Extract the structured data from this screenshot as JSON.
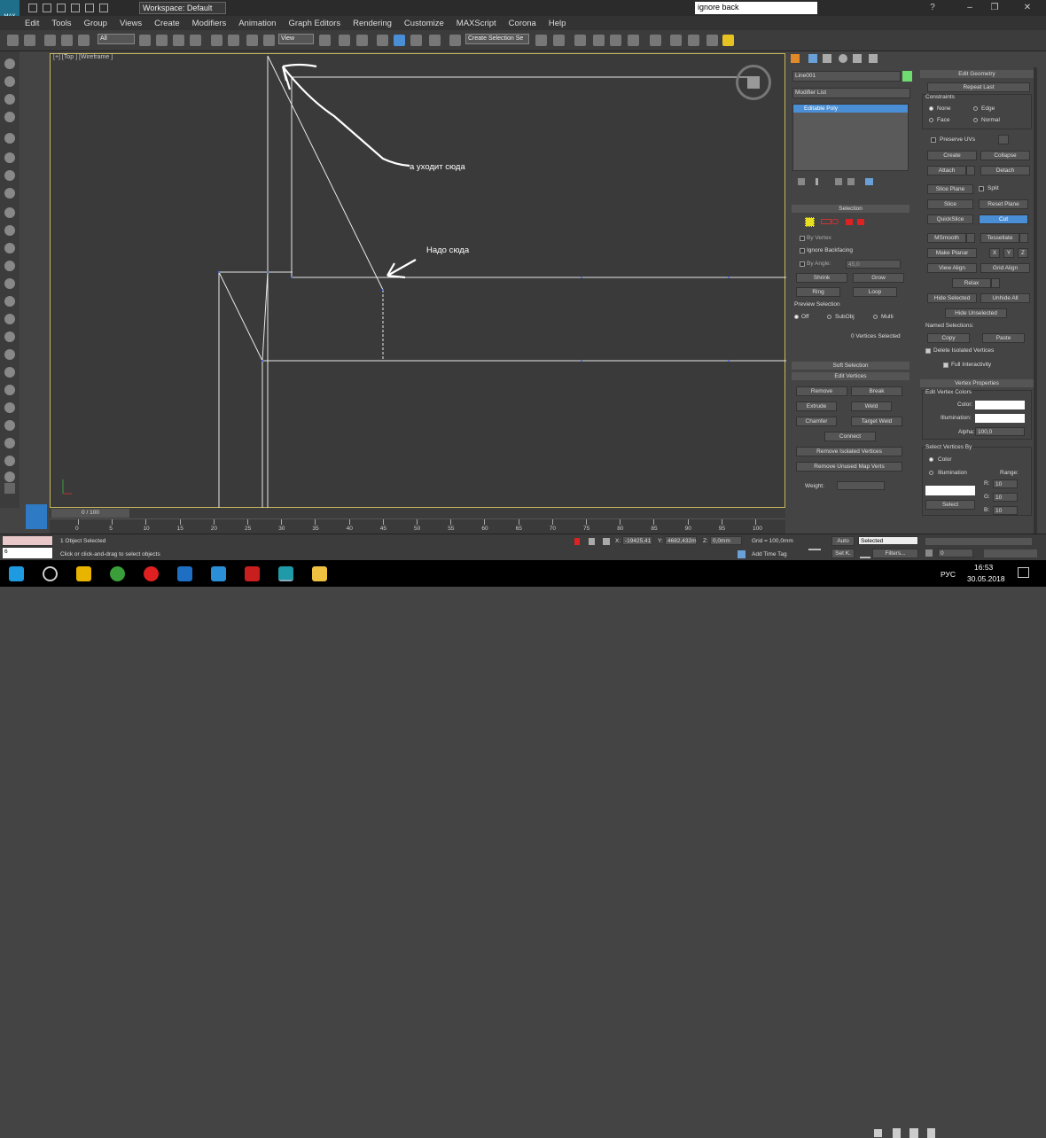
{
  "window": {
    "search_text": "ignore back",
    "workspace": "Workspace: Default",
    "logo_text": "MAX"
  },
  "menu": [
    "Edit",
    "Tools",
    "Group",
    "Views",
    "Create",
    "Modifiers",
    "Animation",
    "Graph Editors",
    "Rendering",
    "Customize",
    "MAXScript",
    "Corona",
    "Help"
  ],
  "toolbar": {
    "selection_filter": "All",
    "ref_coord": "View",
    "named_sel": "Create Selection Se"
  },
  "viewport": {
    "label": "[+] [Top ] [Wireframe ]",
    "annotation_1": "а уходит сюда",
    "annotation_2": "Надо сюда"
  },
  "command_panel": {
    "object_name": "Line001",
    "object_color": "#6fdc6f",
    "modifier_list": "Modifier List",
    "stack_item": "Editable Poly",
    "selection": {
      "header": "Selection",
      "by_vertex": "By Vertex",
      "ignore_backfacing": "Ignore Backfacing",
      "by_angle": "By Angle:",
      "angle_value": "45,0",
      "shrink": "Shrink",
      "grow": "Grow",
      "ring": "Ring",
      "loop": "Loop",
      "preview": "Preview Selection",
      "off": "Off",
      "subobj": "SubObj",
      "multi": "Multi",
      "status": "0 Vertices Selected"
    },
    "soft_selection": "Soft Selection",
    "edit_vertices": {
      "header": "Edit Vertices",
      "remove": "Remove",
      "break": "Break",
      "extrude": "Extrude",
      "weld": "Weld",
      "chamfer": "Chamfer",
      "target_weld": "Target Weld",
      "connect": "Connect",
      "remove_isolated": "Remove Isolated Vertices",
      "remove_unused": "Remove Unused Map Verts",
      "weight": "Weight:"
    }
  },
  "right_panel": {
    "edit_geometry": "Edit Geometry",
    "repeat_last": "Repeat Last",
    "constraints": "Constraints",
    "none": "None",
    "edge": "Edge",
    "face": "Face",
    "normal": "Normal",
    "preserve_uvs": "Preserve UVs",
    "create": "Create",
    "collapse": "Collapse",
    "attach": "Attach",
    "detach": "Detach",
    "slice_plane": "Slice Plane",
    "split": "Split",
    "slice": "Slice",
    "reset_plane": "Reset Plane",
    "quickslice": "QuickSlice",
    "cut": "Cut",
    "msmooth": "MSmooth",
    "tessellate": "Tessellate",
    "make_planar": "Make Planar",
    "x": "X",
    "y": "Y",
    "z": "Z",
    "view_align": "View Align",
    "grid_align": "Grid Align",
    "relax": "Relax",
    "hide_selected": "Hide Selected",
    "unhide_all": "Unhide All",
    "hide_unselected": "Hide Unselected",
    "named_selections": "Named Selections:",
    "copy": "Copy",
    "paste": "Paste",
    "delete_isolated": "Delete Isolated Vertices",
    "full_interactivity": "Full Interactivity",
    "vertex_properties": "Vertex Properties",
    "edit_vertex_colors": "Edit Vertex Colors",
    "color": "Color:",
    "illumination": "Illumination:",
    "alpha": "Alpha:",
    "alpha_value": "100,0",
    "select_vertices_by": "Select Vertices By",
    "color_radio": "Color",
    "illumination_radio": "Illumination",
    "range": "Range:",
    "r": "R:",
    "g": "G:",
    "b": "B:",
    "r_val": "10",
    "g_val": "10",
    "b_val": "10",
    "select": "Select"
  },
  "timeline": {
    "frame": "0 / 100",
    "ticks": [
      "0",
      "5",
      "10",
      "15",
      "20",
      "25",
      "30",
      "35",
      "40",
      "45",
      "50",
      "55",
      "60",
      "65",
      "70",
      "75",
      "80",
      "85",
      "90",
      "95",
      "100"
    ]
  },
  "status": {
    "selected": "1 Object Selected",
    "prompt": "Click or click-and-drag to select objects",
    "x_label": "X:",
    "x_value": "-19425,41",
    "y_label": "Y:",
    "y_value": "4682,432m",
    "z_label": "Z:",
    "z_value": "0,0mm",
    "grid": "Grid = 100,0mm",
    "add_time_tag": "Add Time Tag",
    "auto": "Auto",
    "set_key": "Set K.",
    "key_mode": "Selected",
    "filters": "Filters...",
    "frame_field": "0",
    "mini_listener_value": "6"
  },
  "taskbar": {
    "time": "16:53",
    "date": "30.05.2018",
    "lang": "РУС"
  }
}
